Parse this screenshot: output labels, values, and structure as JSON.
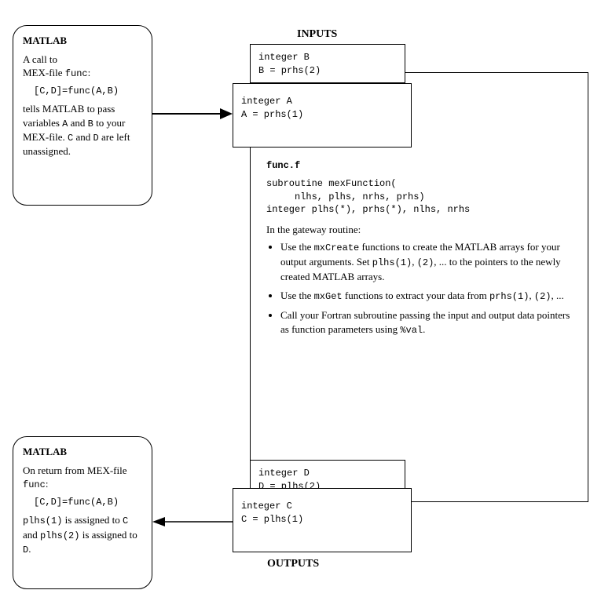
{
  "headings": {
    "inputs": "INPUTS",
    "outputs": "OUTPUTS"
  },
  "matlab_top": {
    "title": "MATLAB",
    "line1_a": "A call to",
    "line1_b": "MEX-file ",
    "line1_c": "func",
    "line1_d": ":",
    "code": "[C,D]=func(A,B)",
    "tail1": "tells MATLAB to pass variables ",
    "tail2": "A",
    "tail3": " and ",
    "tail4": "B",
    "tail5": " to your MEX-file. ",
    "tail6": "C",
    "tail7": " and ",
    "tail8": "D",
    "tail9": " are left unassigned."
  },
  "matlab_bottom": {
    "title": "MATLAB",
    "line1_a": "On return from MEX-file ",
    "line1_b": "func",
    "line1_c": ":",
    "code": "[C,D]=func(A,B)",
    "tail1": "plhs(1)",
    "tail2": " is assigned to ",
    "tail3": "C",
    "tail4": " and ",
    "tail5": "plhs(2)",
    "tail6": " is assigned to ",
    "tail7": "D",
    "tail8": "."
  },
  "input_b": {
    "l1": "integer B",
    "l2": "B = prhs(2)"
  },
  "input_a": {
    "l1": "integer A",
    "l2": "A = prhs(1)"
  },
  "output_d": {
    "l1": "integer D",
    "l2": "D = plhs(2)"
  },
  "output_c": {
    "l1": "integer C",
    "l2": "C = plhs(1)"
  },
  "func": {
    "name": "func.f",
    "sub1": "subroutine mexFunction(",
    "sub2": "     nlhs, plhs, nrhs, prhs)",
    "sub3": "integer plhs(*), prhs(*), nlhs, nrhs",
    "gateway": "In the gateway routine:",
    "b1_a": "Use the ",
    "b1_b": "mxCreate",
    "b1_c": " functions to create the MATLAB arrays for your output arguments. Set ",
    "b1_d": "plhs(1)",
    "b1_e": ", ",
    "b1_f": "(2)",
    "b1_g": ", ... to the pointers to the newly created MATLAB arrays.",
    "b2_a": "Use the ",
    "b2_b": "mxGet",
    "b2_c": " functions to extract your data from ",
    "b2_d": "prhs(1)",
    "b2_e": ", ",
    "b2_f": "(2)",
    "b2_g": ", ...",
    "b3_a": "Call your Fortran subroutine passing the input and output data pointers as function parameters using ",
    "b3_b": "%val",
    "b3_c": "."
  }
}
